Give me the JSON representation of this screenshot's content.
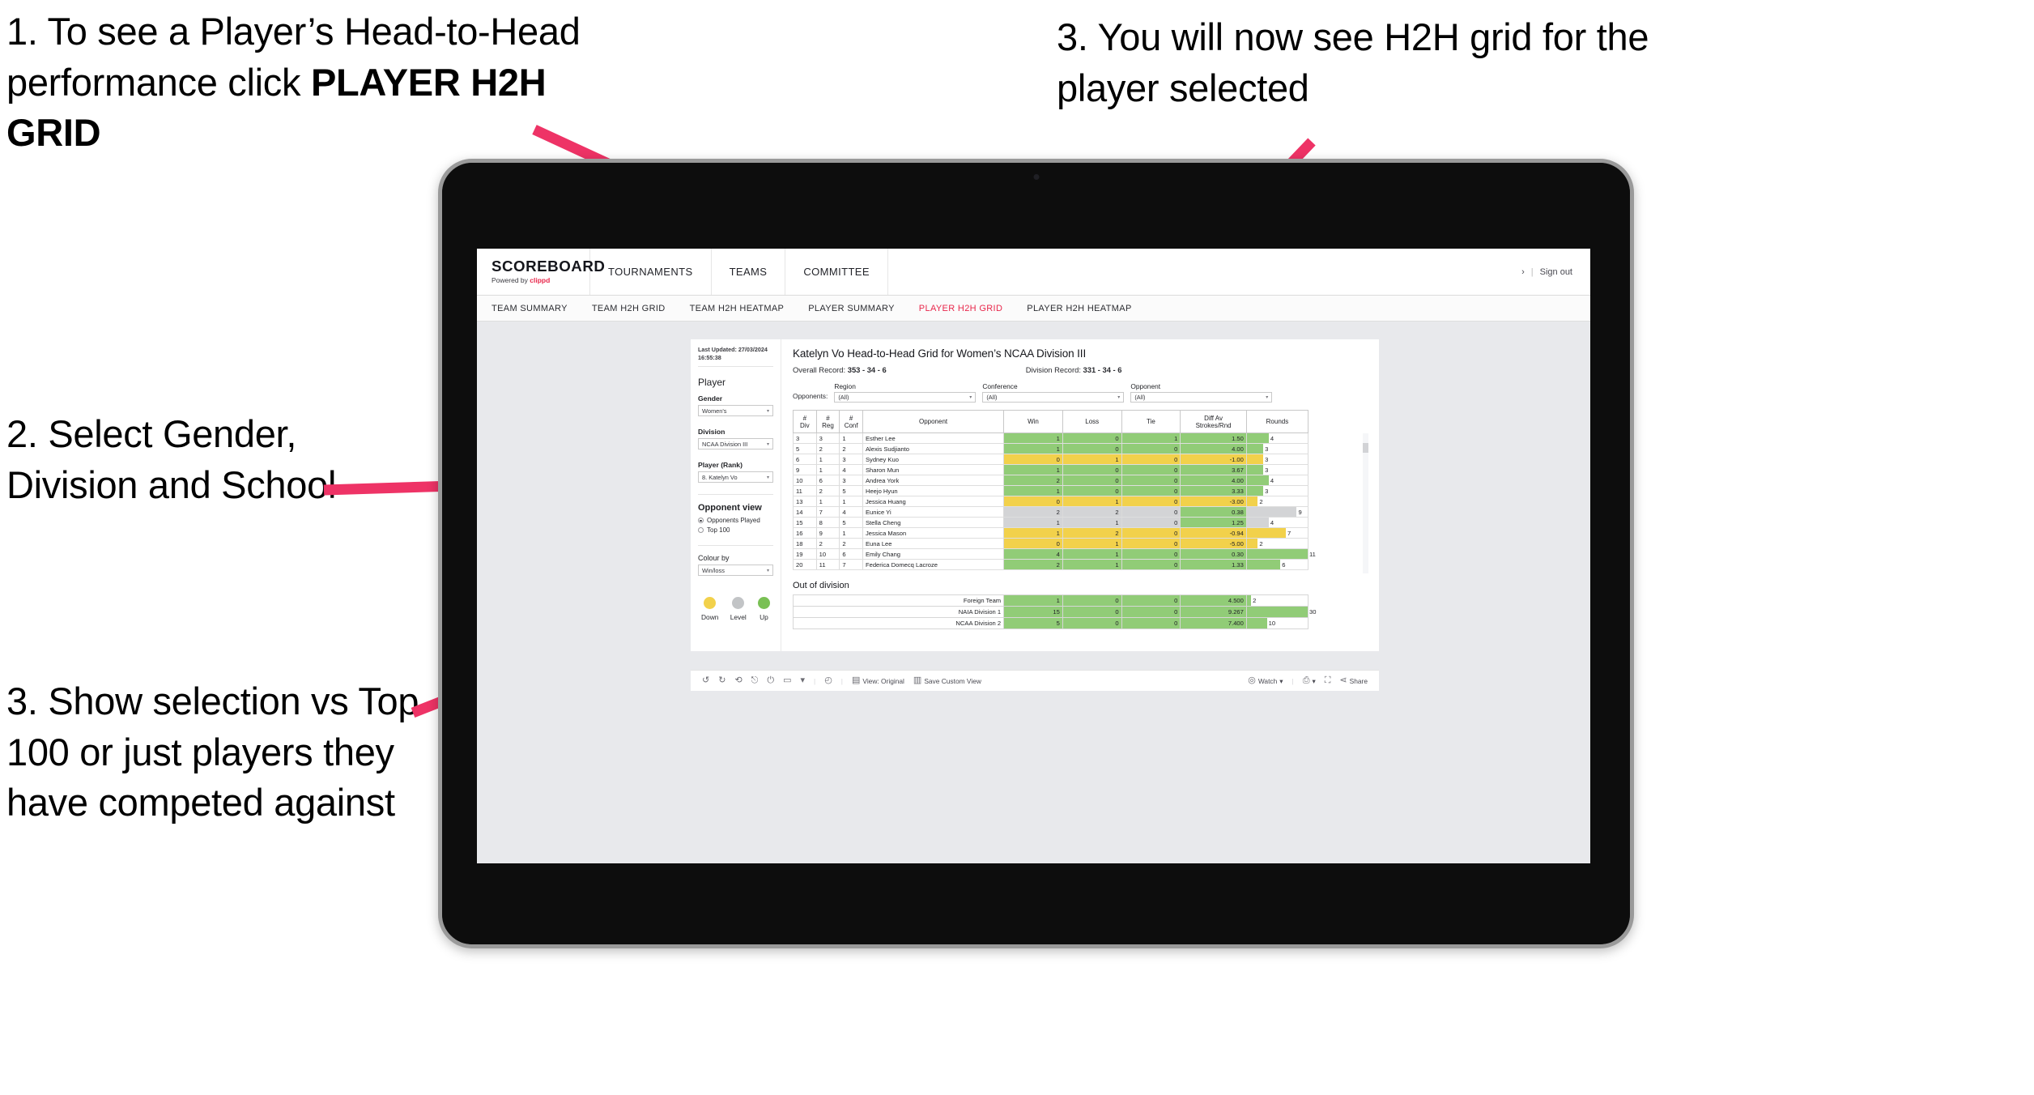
{
  "annotations": {
    "one_part1": "1. To see a Player’s Head-to-Head performance click ",
    "one_part2": "PLAYER H2H GRID",
    "two": "2. Select Gender, Division and School",
    "three": "3. Show selection vs Top 100 or just players they have competed against",
    "four": "3. You will now see H2H grid for the player selected",
    "arrow_color": "#EE3366"
  },
  "header": {
    "brand_title": "SCOREBOARD",
    "brand_sub_prefix": "Powered by ",
    "brand_sub_name": "clippd",
    "nav": [
      {
        "label": "TOURNAMENTS"
      },
      {
        "label": "TEAMS"
      },
      {
        "label": "COMMITTEE"
      }
    ],
    "account_icon": "›",
    "separator": "|",
    "sign_out": "Sign out"
  },
  "sub_nav": {
    "items": [
      {
        "label": "TEAM SUMMARY",
        "active": false
      },
      {
        "label": "TEAM H2H GRID",
        "active": false
      },
      {
        "label": "TEAM H2H HEATMAP",
        "active": false
      },
      {
        "label": "PLAYER SUMMARY",
        "active": false
      },
      {
        "label": "PLAYER H2H GRID",
        "active": true
      },
      {
        "label": "PLAYER H2H HEATMAP",
        "active": false
      }
    ],
    "active_color": "#E8274B"
  },
  "sidebar": {
    "last_updated": "Last Updated: 27/03/2024 16:55:38",
    "player_heading": "Player",
    "gender_label": "Gender",
    "gender_value": "Women's",
    "division_label": "Division",
    "division_value": "NCAA Division III",
    "player_rank_label": "Player (Rank)",
    "player_rank_value": "8. Katelyn Vo",
    "opponent_view_heading": "Opponent view",
    "opponent_view_options": [
      {
        "label": "Opponents Played",
        "selected": true
      },
      {
        "label": "Top 100",
        "selected": false
      }
    ],
    "colour_by_label": "Colour by",
    "colour_by_value": "Win/loss",
    "legend": [
      {
        "label": "Down",
        "color": "#F2D14B"
      },
      {
        "label": "Level",
        "color": "#C2C4C6"
      },
      {
        "label": "Up",
        "color": "#79C054"
      }
    ]
  },
  "main": {
    "title": "Katelyn Vo Head-to-Head Grid for Women’s NCAA Division III",
    "overall_record_label": "Overall Record: ",
    "overall_record_value": "353 - 34 - 6",
    "division_record_label": "Division Record: ",
    "division_record_value": "331 - 34 - 6",
    "opponents_label": "Opponents:",
    "filters": [
      {
        "label": "Region",
        "value": "(All)"
      },
      {
        "label": "Conference",
        "value": "(All)"
      },
      {
        "label": "Opponent",
        "value": "(All)"
      }
    ],
    "out_of_division_title": "Out of division"
  },
  "chart_data": {
    "type": "table",
    "title": "Katelyn Vo Head-to-Head Grid for Women’s NCAA Division III",
    "columns": [
      "# Div",
      "# Reg",
      "# Conf",
      "Opponent",
      "Win",
      "Loss",
      "Tie",
      "Diff Av Strokes/Rnd",
      "Rounds"
    ],
    "column_headers_multiline": [
      [
        "#",
        "Div"
      ],
      [
        "#",
        "Reg"
      ],
      [
        "#",
        "Conf"
      ],
      [
        "Opponent"
      ],
      [
        "Win"
      ],
      [
        "Loss"
      ],
      [
        "Tie"
      ],
      [
        "Diff Av",
        "Strokes/Rnd"
      ],
      [
        "Rounds"
      ]
    ],
    "rows": [
      {
        "div": "3",
        "reg": "3",
        "conf": "1",
        "opponent": "Esther Lee",
        "win": "1",
        "loss": "0",
        "tie": "1",
        "diff": "1.50",
        "rounds": "4",
        "state": "up",
        "bar_pct": 36
      },
      {
        "div": "5",
        "reg": "2",
        "conf": "2",
        "opponent": "Alexis Sudjianto",
        "win": "1",
        "loss": "0",
        "tie": "0",
        "diff": "4.00",
        "rounds": "3",
        "state": "up",
        "bar_pct": 27
      },
      {
        "div": "6",
        "reg": "1",
        "conf": "3",
        "opponent": "Sydney Kuo",
        "win": "0",
        "loss": "1",
        "tie": "0",
        "diff": "-1.00",
        "rounds": "3",
        "state": "down",
        "bar_pct": 27
      },
      {
        "div": "9",
        "reg": "1",
        "conf": "4",
        "opponent": "Sharon Mun",
        "win": "1",
        "loss": "0",
        "tie": "0",
        "diff": "3.67",
        "rounds": "3",
        "state": "up",
        "bar_pct": 27
      },
      {
        "div": "10",
        "reg": "6",
        "conf": "3",
        "opponent": "Andrea York",
        "win": "2",
        "loss": "0",
        "tie": "0",
        "diff": "4.00",
        "rounds": "4",
        "state": "up",
        "bar_pct": 36
      },
      {
        "div": "11",
        "reg": "2",
        "conf": "5",
        "opponent": "Heejo Hyun",
        "win": "1",
        "loss": "0",
        "tie": "0",
        "diff": "3.33",
        "rounds": "3",
        "state": "up",
        "bar_pct": 27
      },
      {
        "div": "13",
        "reg": "1",
        "conf": "1",
        "opponent": "Jessica Huang",
        "win": "0",
        "loss": "1",
        "tie": "0",
        "diff": "-3.00",
        "rounds": "2",
        "state": "down",
        "bar_pct": 18
      },
      {
        "div": "14",
        "reg": "7",
        "conf": "4",
        "opponent": "Eunice Yi",
        "win": "2",
        "loss": "2",
        "tie": "0",
        "diff": "0.38",
        "rounds": "9",
        "state": "level",
        "bar_pct": 82,
        "diff_state": "up"
      },
      {
        "div": "15",
        "reg": "8",
        "conf": "5",
        "opponent": "Stella Cheng",
        "win": "1",
        "loss": "1",
        "tie": "0",
        "diff": "1.25",
        "rounds": "4",
        "state": "level",
        "bar_pct": 36,
        "diff_state": "up"
      },
      {
        "div": "16",
        "reg": "9",
        "conf": "1",
        "opponent": "Jessica Mason",
        "win": "1",
        "loss": "2",
        "tie": "0",
        "diff": "-0.94",
        "rounds": "7",
        "state": "down",
        "bar_pct": 64
      },
      {
        "div": "18",
        "reg": "2",
        "conf": "2",
        "opponent": "Euna Lee",
        "win": "0",
        "loss": "1",
        "tie": "0",
        "diff": "-5.00",
        "rounds": "2",
        "state": "down",
        "bar_pct": 18
      },
      {
        "div": "19",
        "reg": "10",
        "conf": "6",
        "opponent": "Emily Chang",
        "win": "4",
        "loss": "1",
        "tie": "0",
        "diff": "0.30",
        "rounds": "11",
        "state": "up",
        "bar_pct": 100
      },
      {
        "div": "20",
        "reg": "11",
        "conf": "7",
        "opponent": "Federica Domecq Lacroze",
        "win": "2",
        "loss": "1",
        "tie": "0",
        "diff": "1.33",
        "rounds": "6",
        "state": "up",
        "bar_pct": 55
      }
    ],
    "out_of_division": {
      "title": "Out of division",
      "rows": [
        {
          "name": "Foreign Team",
          "win": "1",
          "loss": "0",
          "tie": "0",
          "diff": "4.500",
          "rounds": "2",
          "state": "up",
          "bar_pct": 7
        },
        {
          "name": "NAIA Division 1",
          "win": "15",
          "loss": "0",
          "tie": "0",
          "diff": "9.267",
          "rounds": "30",
          "state": "up",
          "bar_pct": 100
        },
        {
          "name": "NCAA Division 2",
          "win": "5",
          "loss": "0",
          "tie": "0",
          "diff": "7.400",
          "rounds": "10",
          "state": "up",
          "bar_pct": 33
        }
      ]
    },
    "colors": {
      "up": "#91CC77",
      "down": "#F2D14B",
      "level": "#D3D4D6",
      "bar": "#91CC77"
    }
  },
  "toolbar": {
    "undo_icon": "↺",
    "redo_icon": "↻",
    "revert_icon": "⟲",
    "refresh_icon": "⎋",
    "pause_icon": "⏻",
    "share_shape_icon": "▭",
    "caret_icon": "▾",
    "alert_icon": "◴",
    "view_label": "View: Original",
    "save_label": "Save Custom View",
    "watch_label": "Watch",
    "download_icon": "⎙",
    "fullscreen_icon": "⛶",
    "share_label": "Share"
  }
}
